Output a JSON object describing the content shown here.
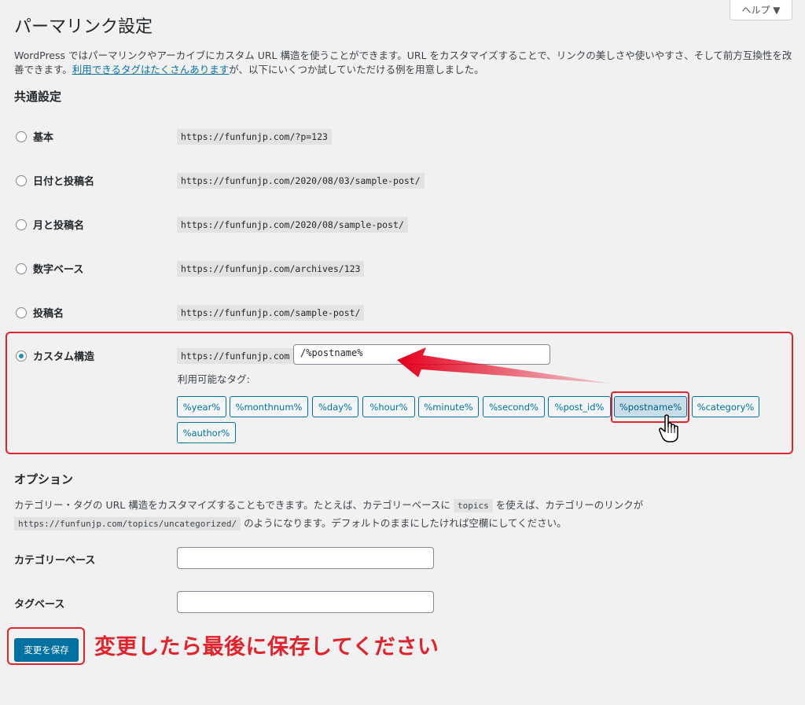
{
  "help_button": "ヘルプ ▼",
  "page_title": "パーマリンク設定",
  "intro": {
    "text_before_link": "WordPress ではパーマリンクやアーカイブにカスタム URL 構造を使うことができます。URL をカスタマイズすることで、リンクの美しさや使いやすさ、そして前方互換性を改善できます。",
    "link_text": "利用できるタグはたくさんあります",
    "text_after_link": "が、以下にいくつか試していただける例を用意しました。"
  },
  "common_settings": {
    "heading": "共通設定",
    "options": [
      {
        "label": "基本",
        "example": "https://funfunjp.com/?p=123",
        "selected": false
      },
      {
        "label": "日付と投稿名",
        "example": "https://funfunjp.com/2020/08/03/sample-post/",
        "selected": false
      },
      {
        "label": "月と投稿名",
        "example": "https://funfunjp.com/2020/08/sample-post/",
        "selected": false
      },
      {
        "label": "数字ベース",
        "example": "https://funfunjp.com/archives/123",
        "selected": false
      },
      {
        "label": "投稿名",
        "example": "https://funfunjp.com/sample-post/",
        "selected": false
      }
    ],
    "custom": {
      "label": "カスタム構造",
      "base_url": "https://funfunjp.com",
      "value": "/%postname%",
      "selected": true,
      "tags_label": "利用可能なタグ:",
      "tags": [
        "%year%",
        "%monthnum%",
        "%day%",
        "%hour%",
        "%minute%",
        "%second%",
        "%post_id%",
        "%postname%",
        "%category%",
        "%author%"
      ],
      "active_tag": "%postname%"
    }
  },
  "options_section": {
    "heading": "オプション",
    "desc_1": "カテゴリー・タグの URL 構造をカスタマイズすることもできます。たとえば、カテゴリーベースに",
    "code_1": "topics",
    "desc_2": "を使えば、カテゴリーのリンクが",
    "code_2": "https://funfunjp.com/topics/uncategorized/",
    "desc_3": "のようになります。デフォルトのままにしたければ空欄にしてください。",
    "category_base_label": "カテゴリーベース",
    "category_base_value": "",
    "tag_base_label": "タグベース",
    "tag_base_value": ""
  },
  "save_button": "変更を保存",
  "annotation": "変更したら最後に保存してください",
  "colors": {
    "accent": "#0071a1",
    "highlight": "#e3232c"
  }
}
